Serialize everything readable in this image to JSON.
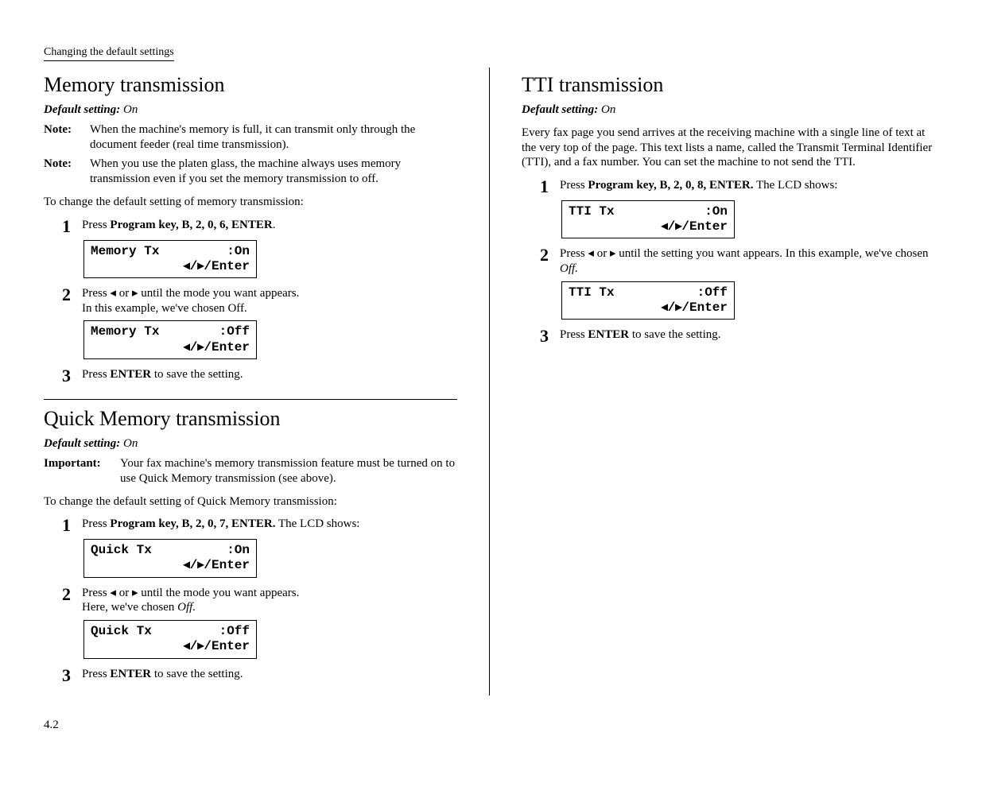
{
  "header": {
    "section_label": "Changing the default settings"
  },
  "page_number": "4.2",
  "lcd_nav": "◂/▸/Enter",
  "left": {
    "memory": {
      "title": "Memory transmission",
      "default_label": "Default setting:",
      "default_value": "On",
      "note_label": "Note:",
      "note1": "When the machine's memory is full, it can transmit only through the document feeder (real time transmission).",
      "note2": "When you use the platen glass, the machine always uses memory transmission even if you set the memory transmission to off.",
      "intro": "To change the default setting of memory transmission:",
      "step1_pre": "Press ",
      "step1_bold": "Program key, B, 2, 0, 6, ENTER",
      "step1_post": ".",
      "lcd1_left": "Memory Tx",
      "lcd1_right": ":On",
      "step2a": "Press ◂ or ▸ until the mode you want appears.",
      "step2b": "In this example, we've chosen Off.",
      "lcd2_left": "Memory Tx",
      "lcd2_right": ":Off",
      "step3_pre": "Press ",
      "step3_bold": "ENTER",
      "step3_post": " to save the setting."
    },
    "quick": {
      "title": "Quick Memory transmission",
      "default_label": "Default setting:",
      "default_value": "On",
      "important_label": "Important:",
      "important_text": "Your fax machine's memory transmission feature must be turned on to use Quick Memory transmission (see above).",
      "intro": "To change the default setting of Quick Memory transmission:",
      "step1_pre": "Press ",
      "step1_bold": "Program key, B, 2, 0, 7, ENTER.",
      "step1_post_a": " The ",
      "step1_post_sc": "LCD",
      "step1_post_b": " shows:",
      "lcd1_left": "Quick Tx",
      "lcd1_right": ":On",
      "step2a": "Press ◂ or ▸ until the mode you want appears.",
      "step2b_pre": "Here, we've chosen ",
      "step2b_it": "Off.",
      "lcd2_left": "Quick Tx",
      "lcd2_right": ":Off",
      "step3_pre": "Press ",
      "step3_bold": "ENTER",
      "step3_post": " to save the setting."
    }
  },
  "right": {
    "tti": {
      "title": "TTI transmission",
      "default_label": "Default setting:",
      "default_value": "On",
      "para_a": "Every fax page you send arrives at the receiving machine with a single line of text at the very top of the page. This text lists a name, called the Transmit Terminal Identifier (",
      "para_sc1": "TTI",
      "para_b": "), and a fax number. You can set the machine to not send the ",
      "para_sc2": "TTI",
      "para_c": ".",
      "step1_pre": "Press ",
      "step1_bold": "Program key, B, 2, 0, 8, ENTER.",
      "step1_post_a": " The ",
      "step1_post_sc": "LCD",
      "step1_post_b": " shows:",
      "lcd1_left": "TTI Tx",
      "lcd1_right": ":On",
      "step2a": "Press ◂ or ▸ until the setting you want appears. In this example, we've chosen ",
      "step2_it": "Off.",
      "lcd2_left": "TTI Tx",
      "lcd2_right": ":Off",
      "step3_pre": "Press ",
      "step3_bold": "ENTER",
      "step3_post": " to save the setting."
    }
  }
}
